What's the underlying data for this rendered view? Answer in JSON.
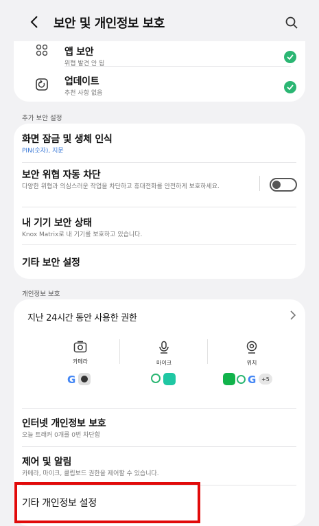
{
  "header": {
    "title": "보안 및 개인정보 보호"
  },
  "security_items": [
    {
      "title": "앱 보안",
      "subtitle": "위협 발견 안 됨"
    },
    {
      "title": "업데이트",
      "subtitle": "추천 사항 없음"
    }
  ],
  "additional_security": {
    "label": "추가 보안 설정",
    "items": [
      {
        "title": "화면 잠금 및 생체 인식",
        "subtitle": "PIN(숫자), 지문"
      },
      {
        "title": "보안 위협 자동 차단",
        "subtitle": "다양한 위협과 의심스러운 작업을 차단하고 휴대전화를 안전하게 보호하세요.",
        "toggle_on": false
      },
      {
        "title": "내 기기 보안 상태",
        "subtitle": "Knox Matrix로 내 기기를 보호하고 있습니다."
      },
      {
        "title": "기타 보안 설정"
      }
    ]
  },
  "privacy": {
    "label": "개인정보 보호",
    "recent_permissions_title": "지난 24시간 동안 사용한 권한",
    "permissions": [
      {
        "label": "카메라",
        "icon": "camera-icon"
      },
      {
        "label": "마이크",
        "icon": "mic-icon"
      },
      {
        "label": "위치",
        "icon": "location-icon"
      }
    ],
    "more_apps_count": "+5",
    "items": [
      {
        "title": "인터넷 개인정보 보호",
        "subtitle": "오늘 트래커 0개를 0번 차단함"
      },
      {
        "title": "제어 및 알림",
        "subtitle": "카메라, 마이크, 클립보드 권한을 제어할 수 있습니다."
      },
      {
        "title": "기타 개인정보 설정"
      }
    ]
  },
  "colors": {
    "check_green": "#2bb673",
    "highlight_red": "#e10a0a",
    "link_blue": "#3a78d6"
  }
}
